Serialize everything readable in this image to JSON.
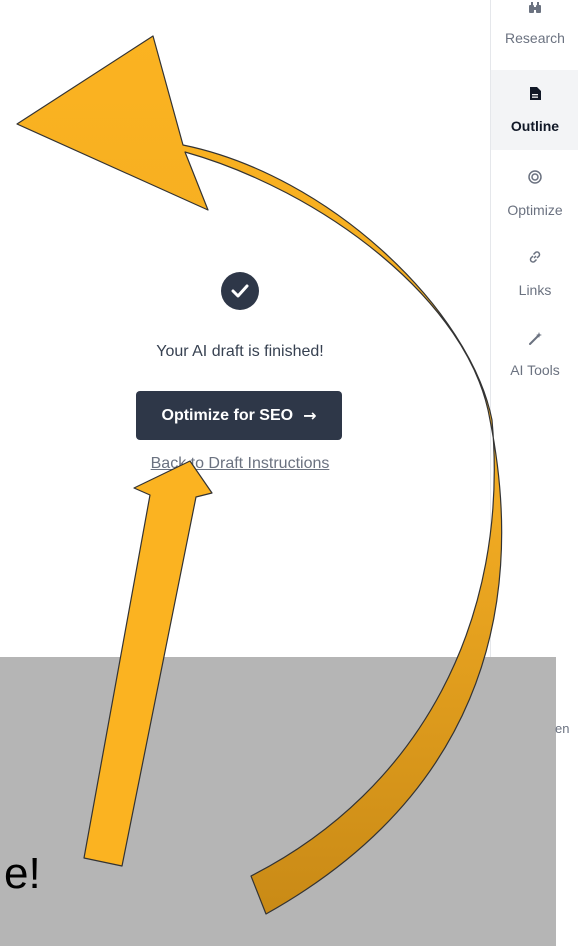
{
  "sidebar": {
    "items": [
      {
        "label": "Research",
        "icon": "binoculars-icon",
        "glyph": "⛯"
      },
      {
        "label": "Outline",
        "icon": "document-icon",
        "glyph": "🗎"
      },
      {
        "label": "Optimize",
        "icon": "target-icon",
        "glyph": "◎"
      },
      {
        "label": "Links",
        "icon": "link-icon",
        "glyph": "🔗"
      },
      {
        "label": "AI Tools",
        "icon": "magic-wand-icon",
        "glyph": "⚚"
      }
    ],
    "active": "Outline"
  },
  "main": {
    "status_message": "Your AI draft is finished!",
    "optimize_button_label": "Optimize for SEO",
    "optimize_button_arrow": "→",
    "back_link_label": "Back to Draft Instructions"
  },
  "overlay": {
    "partial_side_text": "en",
    "big_partial_text": "e!"
  },
  "colors": {
    "primary_dark": "#2e3748",
    "arrow_fill": "#fbb321",
    "arrow_stroke": "#333333",
    "overlay_gray": "#b5b5b5"
  }
}
